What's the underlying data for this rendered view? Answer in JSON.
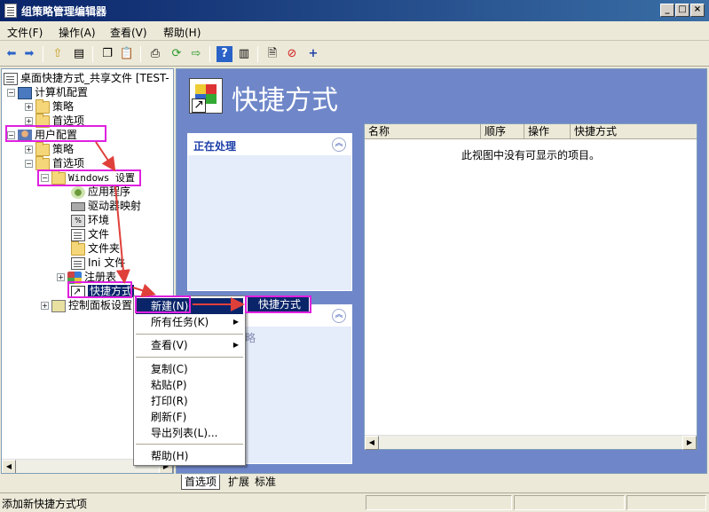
{
  "window": {
    "title": "组策略管理编辑器",
    "buttons": [
      "_",
      "□",
      "×"
    ]
  },
  "menubar": [
    "文件(F)",
    "操作(A)",
    "查看(V)",
    "帮助(H)"
  ],
  "toolbar": {
    "icons": [
      "back-icon",
      "forward-icon",
      "up-folder-icon",
      "show-hide-tree-icon",
      "copy-icon",
      "paste-icon",
      "print-icon",
      "refresh-icon",
      "export-icon",
      "help-icon",
      "show-hide-action-pane-icon",
      "properties-icon",
      "stop-icon",
      "add-icon"
    ]
  },
  "tree": {
    "root": "桌面快捷方式_共享文件 [TEST-",
    "computer_config": "计算机配置",
    "policies_1": "策略",
    "preferences_1": "首选项",
    "user_config": "用户配置",
    "policies_2": "策略",
    "preferences_2": "首选项",
    "windows_settings": "Windows 设置",
    "items": [
      "应用程序",
      "驱动器映射",
      "环境",
      "文件",
      "文件夹",
      "Ini 文件",
      "注册表",
      "快捷方式"
    ],
    "control_panel": "控制面板设置"
  },
  "header": {
    "title": "快捷方式"
  },
  "taskpane": {
    "processing": "正在处理",
    "hint": "略"
  },
  "listview": {
    "columns": [
      "名称",
      "顺序",
      "操作",
      "快捷方式"
    ],
    "empty_text": "此视图中没有可显示的项目。"
  },
  "context_menu": {
    "new": "新建(N)",
    "all_tasks": "所有任务(K)",
    "view": "查看(V)",
    "copy": "复制(C)",
    "paste": "粘贴(P)",
    "print": "打印(R)",
    "refresh": "刷新(F)",
    "export": "导出列表(L)...",
    "help": "帮助(H)"
  },
  "submenu": {
    "shortcut": "快捷方式"
  },
  "tabs": [
    "首选项",
    "扩展",
    "标准"
  ],
  "statusbar": {
    "text": "添加新快捷方式项"
  },
  "colors": {
    "highlight_box": "#e020e0",
    "arrow": "#e0403a",
    "pane_blue": "#6f87c9",
    "selection": "#0a246a"
  }
}
